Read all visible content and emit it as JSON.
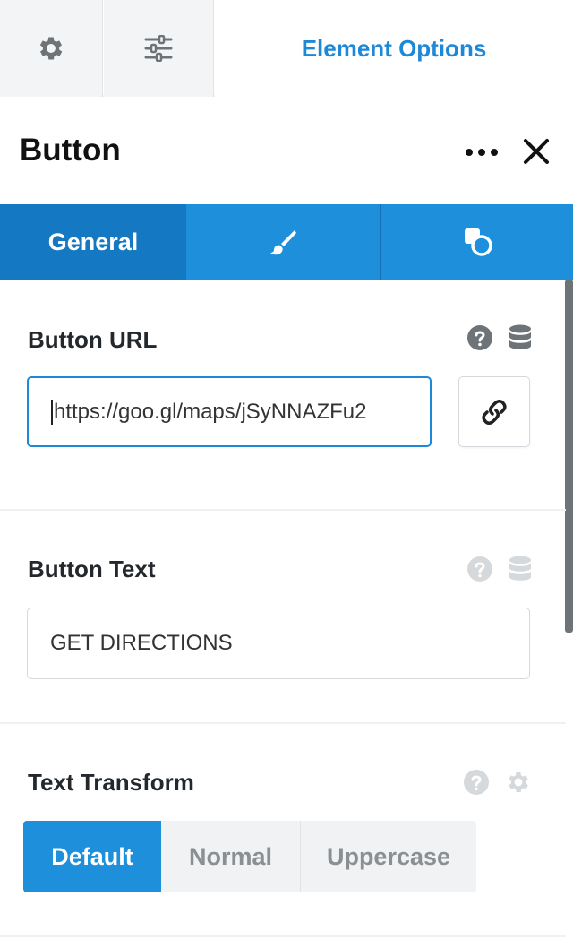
{
  "topbar": {
    "gear_icon": "gear-icon",
    "sliders_icon": "sliders-icon",
    "active_label": "Element Options"
  },
  "panel": {
    "title": "Button",
    "more_icon": "more-horizontal-icon",
    "close_icon": "close-icon"
  },
  "tabs": {
    "general_label": "General",
    "style_icon": "brush-icon",
    "advanced_icon": "shapes-icon"
  },
  "fields": {
    "button_url": {
      "label": "Button URL",
      "value": "https://goo.gl/maps/jSyNNAZFu2"
    },
    "button_text": {
      "label": "Button Text",
      "value": "GET DIRECTIONS"
    },
    "text_transform": {
      "label": "Text Transform",
      "options": [
        "Default",
        "Normal",
        "Uppercase"
      ],
      "selected": "Default"
    }
  },
  "colors": {
    "accent": "#1d8fdb",
    "accent_dark": "#1478c3",
    "icon_gray": "#6e7378",
    "icon_light": "#d6d9dc"
  }
}
